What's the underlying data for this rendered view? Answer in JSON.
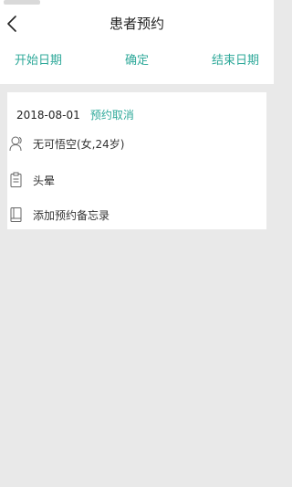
{
  "header": {
    "title": "患者预约"
  },
  "filters": {
    "start_label": "开始日期",
    "confirm_label": "确定",
    "end_label": "结束日期"
  },
  "appointment": {
    "date": "2018-08-01",
    "cancel_label": "预约取消",
    "patient": "无可悟空(女,24岁)",
    "symptom": "头晕",
    "memo_label": "添加预约备忘录"
  },
  "colors": {
    "accent": "#2fa99a",
    "background": "#e9e9e9"
  }
}
